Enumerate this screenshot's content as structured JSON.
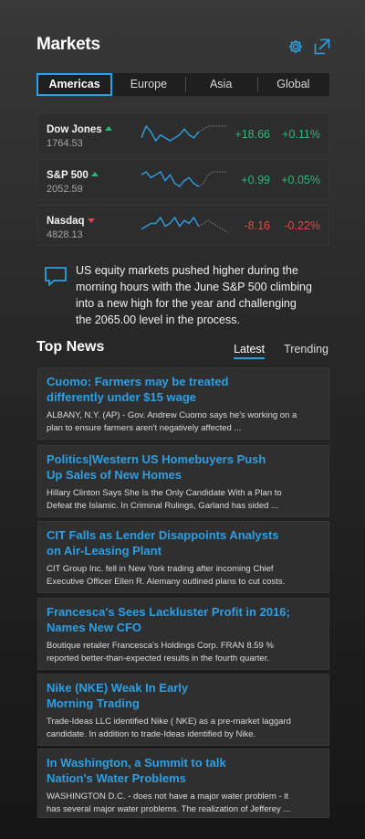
{
  "header": {
    "title": "Markets",
    "settings_icon": "gear-icon",
    "expand_icon": "expand-icon"
  },
  "region_tabs": [
    "Americas",
    "Europe",
    "Asia",
    "Global"
  ],
  "active_region": "Americas",
  "quotes": [
    {
      "name": "Dow Jones",
      "value": "1764.53",
      "change": "+18.66",
      "percent": "+0.11%",
      "direction": "up",
      "spark": [
        5,
        9,
        7,
        4,
        6,
        5,
        4,
        5,
        6,
        8,
        6,
        5,
        7,
        8,
        9,
        9,
        9,
        9,
        9
      ]
    },
    {
      "name": "S&P 500",
      "value": "2052.59",
      "change": "+0.99",
      "percent": "+0.05%",
      "direction": "up",
      "spark": [
        8,
        9,
        7,
        8,
        9,
        6,
        8,
        5,
        4,
        6,
        7,
        5,
        4,
        5,
        8,
        9,
        9,
        9,
        9
      ]
    },
    {
      "name": "Nasdaq",
      "value": "4828.13",
      "change": "-8.16",
      "percent": "-0.22%",
      "direction": "down",
      "spark": [
        5,
        6,
        7,
        7,
        9,
        6,
        7,
        9,
        6,
        8,
        7,
        9,
        6,
        7,
        8,
        7,
        6,
        5,
        4
      ]
    }
  ],
  "colors": {
    "positive": "#2cb978",
    "negative": "#e04848",
    "accent": "#2d9fe3"
  },
  "commentary": {
    "icon": "speech-bubble-icon",
    "lines": [
      "US equity markets pushed higher during the",
      "morning hours with the June S&P 500 climbing",
      "into a new high for the year and challenging",
      "the 2065.00 level in the process."
    ]
  },
  "top_news": {
    "title": "Top News",
    "tabs": [
      "Latest",
      "Trending"
    ],
    "active_tab": "Latest",
    "items": [
      {
        "headline": [
          "Cuomo: Farmers may be treated",
          "differently under $15 wage"
        ],
        "summary": [
          "ALBANY, N.Y. (AP) - Gov. Andrew Cuomo says he's working on a",
          "plan to ensure farmers aren't negatively affected ..."
        ]
      },
      {
        "headline": [
          "Politics|Western US Homebuyers Push",
          "Up Sales of New Homes"
        ],
        "summary": [
          "Hillary Clinton Says She Is the Only Candidate With a Plan to",
          "Defeat the Islamic. In Criminal Rulings, Garland has sided ..."
        ]
      },
      {
        "headline": [
          "CIT Falls as Lender Disappoints Analysts",
          "on Air-Leasing Plant"
        ],
        "summary": [
          "CIT Group Inc. fell in New York trading after incoming Chief",
          "Executive Officer Ellen R. Alemany outlined plans to cut costs."
        ]
      },
      {
        "headline": [
          "Francesca's Sees Lackluster Profit in 2016;",
          "Names New CFO"
        ],
        "summary": [
          "Boutique retailer Francesca's Holdings Corp. FRAN 8.59 %",
          "reported better-than-expected results in the fourth quarter."
        ]
      },
      {
        "headline": [
          "Nike (NKE) Weak In Early",
          "Morning Trading"
        ],
        "summary": [
          "Trade-Ideas LLC identified Nike ( NKE) as a pre-market laggard",
          "candidate. In addition to trade-Ideas identified by Nike."
        ]
      },
      {
        "headline": [
          "In Washington, a Summit to talk",
          "Nation's Water Problems"
        ],
        "summary": [
          "WASHINGTON D.C. - does not have a major water problem - it",
          "has several major water problems. The  realization of Jefferey ..."
        ]
      }
    ]
  }
}
